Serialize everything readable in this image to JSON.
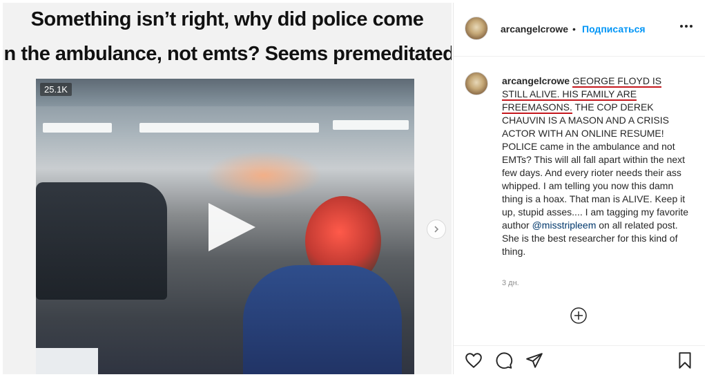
{
  "media": {
    "caption_line1": "Something isn’t right, why did police come",
    "caption_line2": "in the ambulance, not emts? Seems premeditated",
    "view_count": "25.1K"
  },
  "header": {
    "username": "arcangelcrowe",
    "separator": "•",
    "follow_label": "Подписаться"
  },
  "post": {
    "username": "arcangelcrowe",
    "underlined_text": "GEORGE FLOYD IS STILL ALIVE. HIS FAMILY ARE FREEMASONS.",
    "text_part1": " THE COP DEREK CHAUVIN IS A MASON AND A CRISIS ACTOR WITH AN ONLINE RESUME! POLICE came in the ambulance and not EMTs? This will all fall apart within the next few days. And every rioter needs their ass whipped. I am telling you now this damn thing is a hoax. That man is ALIVE. Keep it up, stupid asses.... I am tagging my favorite author ",
    "mention": "@misstripleem",
    "text_part2": " on all related post. She is the best researcher for this kind of thing.",
    "timestamp": "3 дн."
  },
  "icons": {
    "next": "chevron-right-icon",
    "more": "more-horizontal-icon",
    "load_more": "plus-circle-icon",
    "like": "heart-icon",
    "comment": "comment-icon",
    "share": "send-icon",
    "save": "bookmark-icon"
  },
  "colors": {
    "follow": "#0095f6",
    "underline": "#c4161c",
    "mention": "#00376b"
  }
}
